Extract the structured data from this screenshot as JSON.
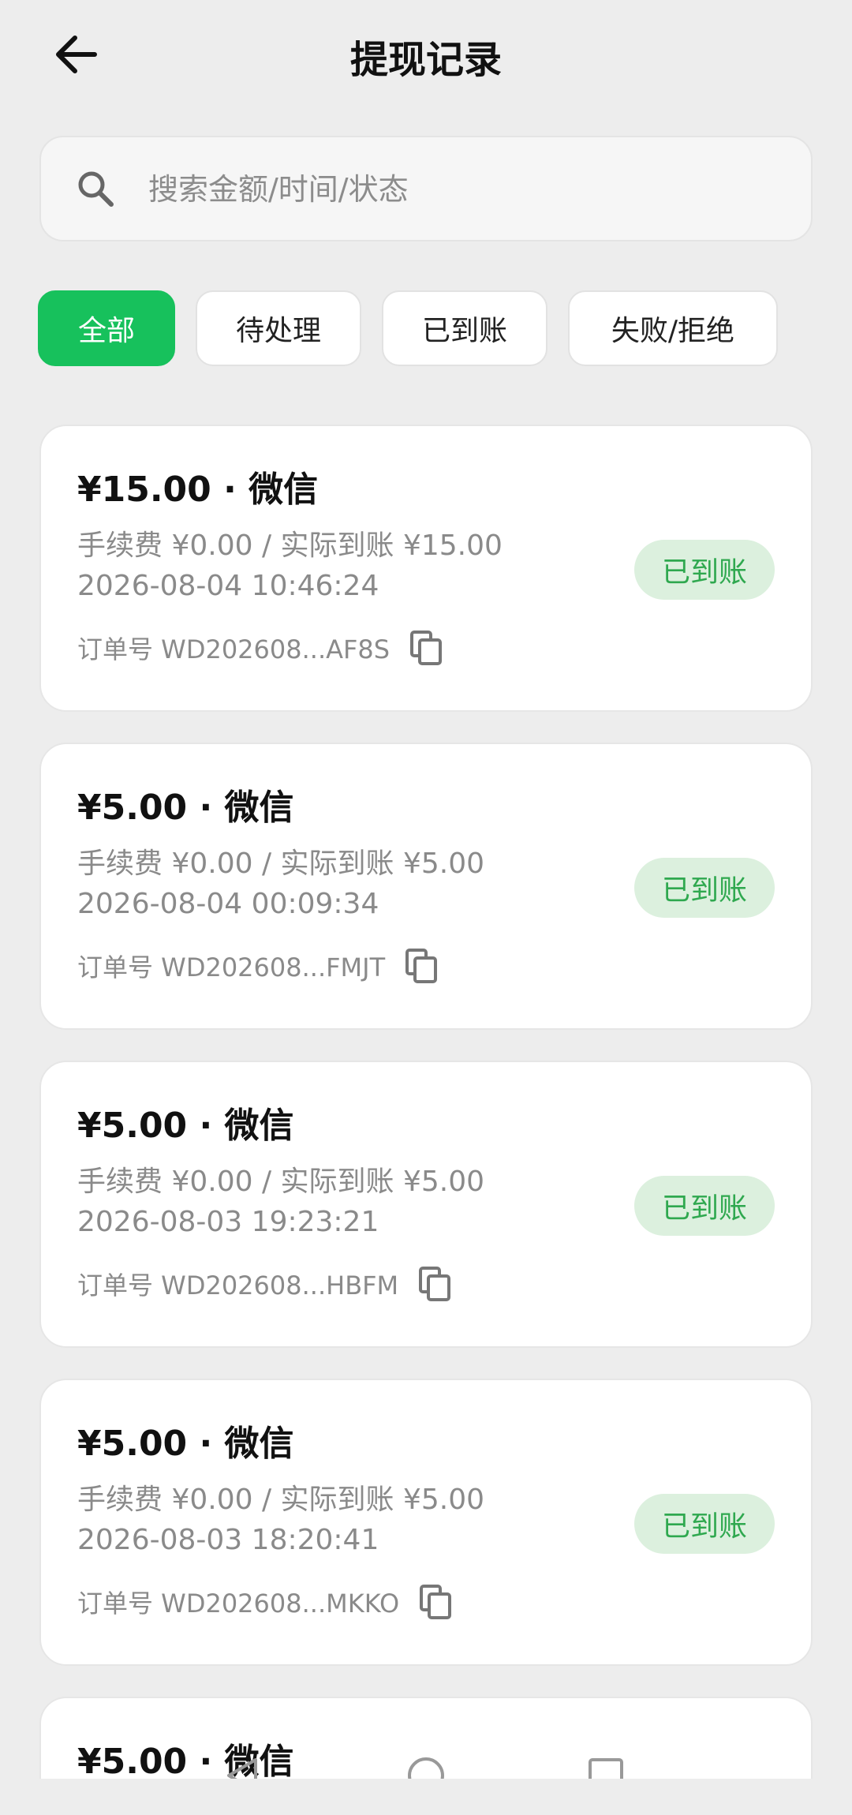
{
  "header": {
    "title": "提现记录",
    "back_icon": "arrow-left-icon"
  },
  "search": {
    "placeholder": "搜索金额/时间/状态",
    "value": "",
    "icon": "search-icon"
  },
  "tabs": [
    {
      "label": "全部",
      "active": true
    },
    {
      "label": "待处理",
      "active": false
    },
    {
      "label": "已到账",
      "active": false
    },
    {
      "label": "失败/拒绝",
      "active": false
    }
  ],
  "records": [
    {
      "title": "¥15.00 · 微信",
      "fee": "手续费 ¥0.00 / 实际到账 ¥15.00",
      "time": "2026-08-04 10:46:24",
      "order": "订单号 WD202608...AF8S",
      "status": "已到账"
    },
    {
      "title": "¥5.00 · 微信",
      "fee": "手续费 ¥0.00 / 实际到账 ¥5.00",
      "time": "2026-08-04 00:09:34",
      "order": "订单号 WD202608...FMJT",
      "status": "已到账"
    },
    {
      "title": "¥5.00 · 微信",
      "fee": "手续费 ¥0.00 / 实际到账 ¥5.00",
      "time": "2026-08-03 19:23:21",
      "order": "订单号 WD202608...HBFM",
      "status": "已到账"
    },
    {
      "title": "¥5.00 · 微信",
      "fee": "手续费 ¥0.00 / 实际到账 ¥5.00",
      "time": "2026-08-03 18:20:41",
      "order": "订单号 WD202608...MKKO",
      "status": "已到账"
    },
    {
      "title": "¥5.00 · 微信"
    }
  ],
  "colors": {
    "accent": "#17c15c",
    "status_bg": "#dcf0de",
    "status_text": "#2fa84f",
    "background": "#ededed"
  }
}
